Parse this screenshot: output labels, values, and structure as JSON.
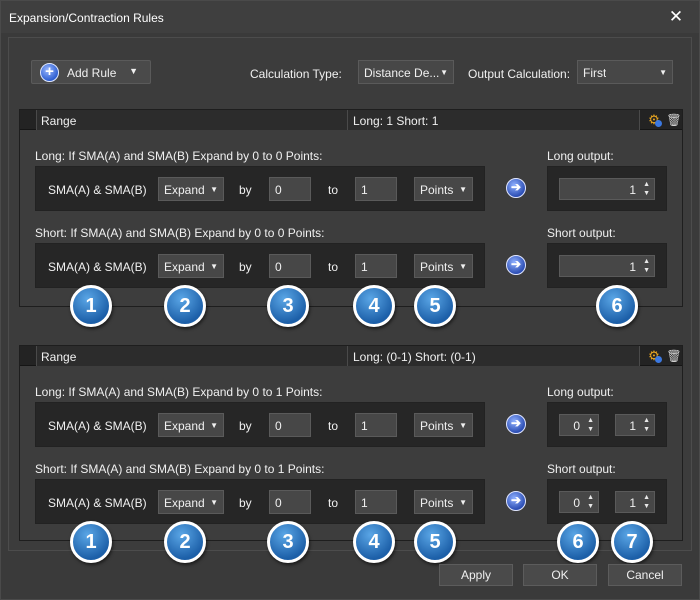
{
  "window": {
    "title": "Expansion/Contraction Rules"
  },
  "toolbar": {
    "add_rule_label": "Add Rule",
    "calc_type_label": "Calculation Type:",
    "calc_type_value": "Distance De...",
    "output_calc_label": "Output Calculation:",
    "output_calc_value": "First"
  },
  "rules": [
    {
      "header": {
        "range_label": "Range",
        "summary": "Long: 1 Short: 1"
      },
      "long": {
        "condition": "Long: If SMA(A) and SMA(B) Expand by 0 to 0 Points:",
        "sma": "SMA(A) & SMA(B)",
        "mode": "Expand",
        "by_label": "by",
        "from": "0",
        "to_label": "to",
        "to": "1",
        "unit": "Points",
        "output_label": "Long output:",
        "outputs": [
          "1"
        ]
      },
      "short": {
        "condition": "Short: If SMA(A) and SMA(B) Expand by 0 to 0 Points:",
        "sma": "SMA(A) & SMA(B)",
        "mode": "Expand",
        "by_label": "by",
        "from": "0",
        "to_label": "to",
        "to": "1",
        "unit": "Points",
        "output_label": "Short output:",
        "outputs": [
          "1"
        ]
      },
      "badges": [
        "1",
        "2",
        "3",
        "4",
        "5",
        "6"
      ]
    },
    {
      "header": {
        "range_label": "Range",
        "summary": "Long: (0-1) Short: (0-1)"
      },
      "long": {
        "condition": "Long: If SMA(A) and SMA(B) Expand by 0 to 1 Points:",
        "sma": "SMA(A) & SMA(B)",
        "mode": "Expand",
        "by_label": "by",
        "from": "0",
        "to_label": "to",
        "to": "1",
        "unit": "Points",
        "output_label": "Long output:",
        "outputs": [
          "0",
          "1"
        ]
      },
      "short": {
        "condition": "Short: If SMA(A) and SMA(B) Expand by 0 to 1 Points:",
        "sma": "SMA(A) & SMA(B)",
        "mode": "Expand",
        "by_label": "by",
        "from": "0",
        "to_label": "to",
        "to": "1",
        "unit": "Points",
        "output_label": "Short output:",
        "outputs": [
          "0",
          "1"
        ]
      },
      "badges": [
        "1",
        "2",
        "3",
        "4",
        "5",
        "6",
        "7"
      ]
    }
  ],
  "footer": {
    "apply": "Apply",
    "ok": "OK",
    "cancel": "Cancel"
  },
  "icons": {
    "close": "close-icon",
    "add": "plus-circle-icon",
    "settings": "gear-icon",
    "delete": "trash-icon",
    "go": "arrow-right-circle-icon"
  }
}
